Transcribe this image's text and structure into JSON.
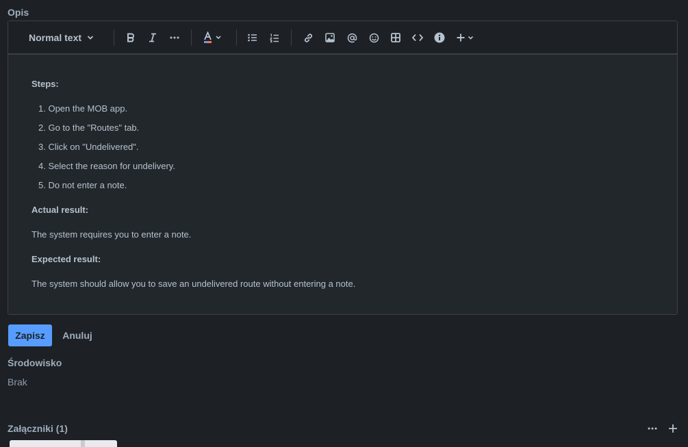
{
  "description": {
    "label": "Opis",
    "toolbar": {
      "text_style": "Normal text",
      "icons": [
        "bold-icon",
        "italic-icon",
        "more-formatting-icon",
        "text-color-icon",
        "bullet-list-icon",
        "numbered-list-icon",
        "link-icon",
        "image-icon",
        "mention-icon",
        "emoji-icon",
        "table-icon",
        "code-icon",
        "info-icon",
        "insert-more-icon"
      ],
      "text_color_accent": "#f87168"
    },
    "content": {
      "steps_heading": "Steps:",
      "steps": [
        "1. Open the MOB app.",
        "2. Go to the \"Routes\" tab.",
        "3. Click on \"Undelivered\".",
        "4. Select the reason for undelivery.",
        "5. Do not enter a note."
      ],
      "actual_heading": "Actual result:",
      "actual_text": "The system requires you to enter a note.",
      "expected_heading": "Expected result:",
      "expected_text": "The system should allow you to save an undelivered route without entering a note."
    }
  },
  "actions": {
    "save_label": "Zapisz",
    "cancel_label": "Anuluj",
    "save_color": "#579dff"
  },
  "environment": {
    "label": "Środowisko",
    "value": "Brak"
  },
  "attachments": {
    "label": "Załączniki (1)"
  }
}
